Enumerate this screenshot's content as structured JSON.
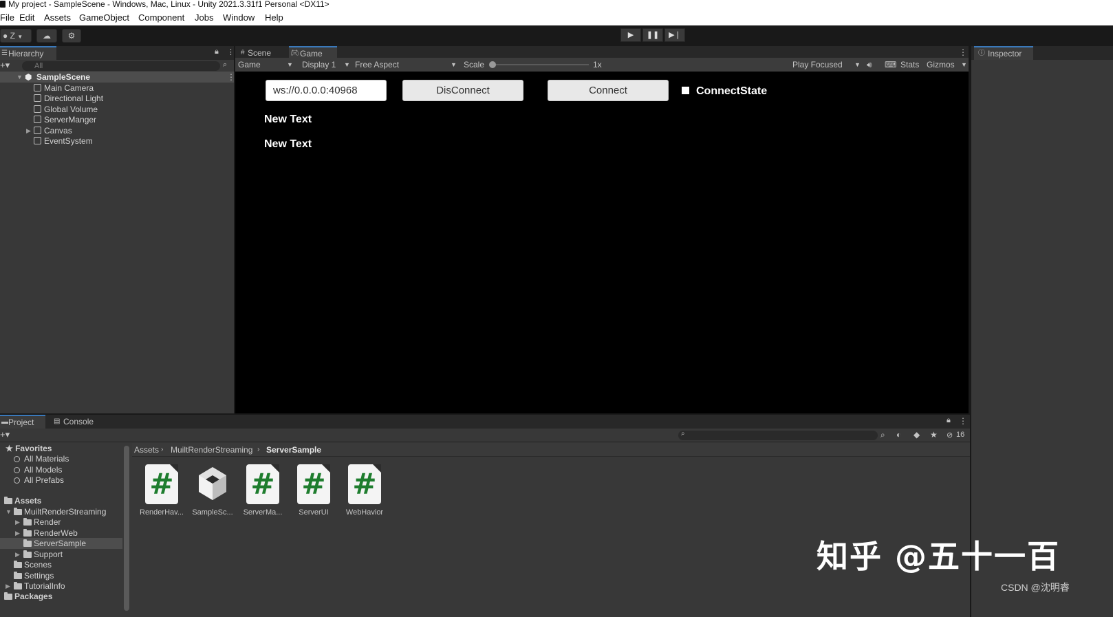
{
  "window": {
    "title": "My project - SampleScene - Windows, Mac, Linux - Unity 2021.3.31f1 Personal <DX11>"
  },
  "menu": [
    "File",
    "Edit",
    "Assets",
    "GameObject",
    "Component",
    "Jobs",
    "Window",
    "Help"
  ],
  "toolbar": {
    "account_label": "Z"
  },
  "hierarchy": {
    "tab_label": "Hierarchy",
    "search_placeholder": "All",
    "scene_name": "SampleScene",
    "items": [
      "Main Camera",
      "Directional Light",
      "Global Volume",
      "ServerManger",
      "Canvas",
      "EventSystem"
    ]
  },
  "center_tabs": {
    "scene": "Scene",
    "game": "Game"
  },
  "game_toolbar": {
    "mode": "Game",
    "display": "Display 1",
    "aspect": "Free Aspect",
    "scale_label": "Scale",
    "scale_value": "1x",
    "play_focused": "Play Focused",
    "stats": "Stats",
    "gizmos": "Gizmos"
  },
  "game_view": {
    "url_input": "ws://0.0.0.0:40968",
    "disconnect_label": "DisConnect",
    "connect_label": "Connect",
    "connect_state_label": "ConnectState",
    "text1": "New Text",
    "text2": "New Text"
  },
  "inspector": {
    "tab_label": "Inspector"
  },
  "bottom_tabs": {
    "project": "Project",
    "console": "Console"
  },
  "project": {
    "hidden_count": "16",
    "favorites_label": "Favorites",
    "favorites": [
      "All Materials",
      "All Models",
      "All Prefabs"
    ],
    "assets_label": "Assets",
    "tree": {
      "root": "MuiltRenderStreaming",
      "children": [
        "Render",
        "RenderWeb",
        "ServerSample",
        "Support"
      ],
      "siblings": [
        "Scenes",
        "Settings",
        "TutorialInfo"
      ]
    },
    "packages_label": "Packages",
    "breadcrumb": [
      "Assets",
      "MuiltRenderStreaming",
      "ServerSample"
    ],
    "files": [
      "RenderHav...",
      "SampleSc...",
      "ServerMa...",
      "ServerUI",
      "WebHavior"
    ]
  },
  "watermark": {
    "main": "知乎 @五十一百",
    "sub": "CSDN @沈明睿"
  }
}
